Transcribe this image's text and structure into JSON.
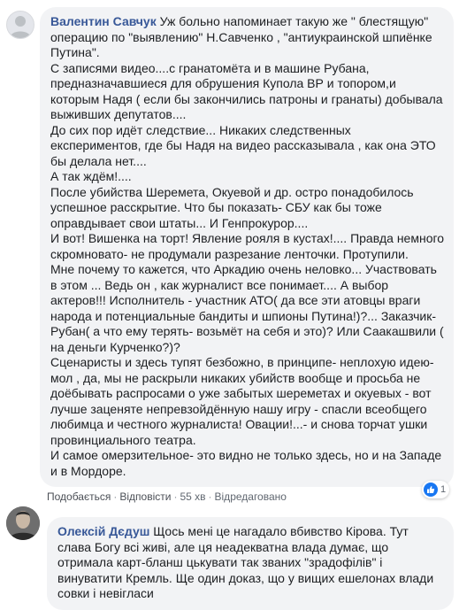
{
  "comments": [
    {
      "author": "Валентин Савчук",
      "lines": [
        " Уж больно напоминает такую же \" блестящую\" операцию по \"выявлению\" Н.Савченко , \"антиукраинской шпиёнке Путина\".",
        "С записями видео....с гранатомёта и в машине Рубана, предназначавшиеся для обрушения Купола ВР и топором,и которым Надя ( если бы закончились патроны и гранаты) добывала выживших депутатов....",
        "До сих пор идёт следствие... Никаких следственных експериментов, где бы Надя на видео рассказывала , как она ЭТО бы делала нет....",
        "А так ждём!....",
        "После убийства Шеремета, Окуевой и др. остро понадобилось успешное расскрытие. Что бы показать- СБУ как бы тоже оправдывает свои штаты... И Генпрокурор....",
        "И вот! Вишенка на торт! Явление рояля в кустах!.... Правда немного скромновато- не продумали разрезание ленточки. Протупили.",
        "Мне почему то кажется, что Аркадию очень неловко... Участвовать в этом ... Ведь он , как журналист все понимает.... А выбор актеров!!! Исполнитель - участник АТО( да все эти атовцы враги народа и потенциальные бандиты и шпионы Путина!)?... Заказчик- Рубан( а что ему терять- возьмёт на себя и это)? Или Саакашвили ( на деньги Курченко?)?",
        "Сценаристы и здесь тупят безбожно, в принципе- неплохую идею- мол , да, мы не раскрыли никаких убийств вообще и просьба не доёбывать распросами о уже забытых шереметах и окуевых - вот лучше заценяте непревзойдённую нашу игру - спасли всеобщего любимца и честного журналиста! Овации!...- и снова торчат ушки провинциального театра.",
        "И самое омерзительное- это видно не только здесь, но и на Западе и в Мордоре."
      ],
      "actions": {
        "like": "Подобається",
        "reply": "Відповісти",
        "time": "55 хв",
        "edited": "Відредаговано"
      },
      "reactions": {
        "icon": "like-icon",
        "count": "1"
      }
    },
    {
      "author": "Олексій Дєдуш",
      "lines": [
        " Щось мені це нагадало вбивство Кірова. Тут слава Богу всі живі, але ця неадекватна влада думає, що отримала карт-бланш цькувати так званих \"зрадофілів\" і винуватити Кремль. Ще один доказ, що у вищих ешелонах влади совки і невігласи"
      ]
    }
  ],
  "colors": {
    "author": "#385898",
    "bubble": "#f2f3f5",
    "like_blue": "#1877f2"
  }
}
